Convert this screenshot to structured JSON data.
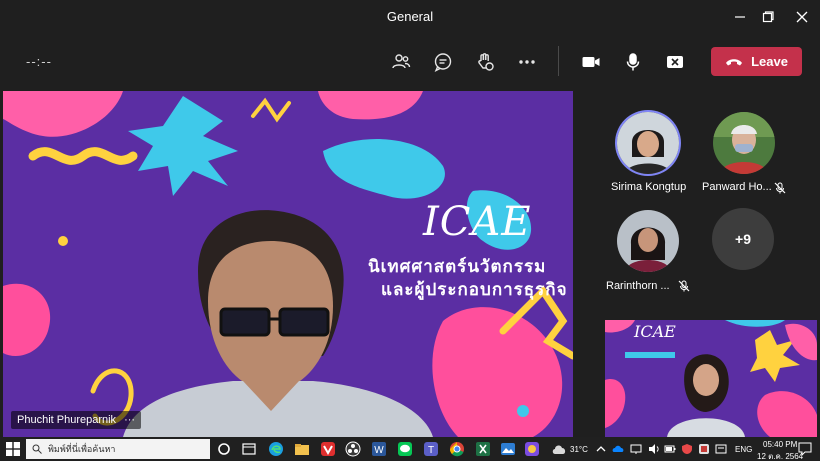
{
  "window": {
    "title": "General",
    "controls": [
      "minimize",
      "maximize",
      "close"
    ]
  },
  "toolbar": {
    "timer": "--:--",
    "icons": [
      "people-icon",
      "chat-icon",
      "reactions-icon",
      "more-icon",
      "camera-icon",
      "mic-icon",
      "share-icon"
    ],
    "leave_label": "Leave",
    "leave_color": "#c4314b"
  },
  "main_video": {
    "brand": "ICAE",
    "tagline_line1": "นิเทศศาสตร์นวัตกรรม",
    "tagline_line2": "และผู้ประกอบการธุรกิจ",
    "speaker_name": "Phuchit Phureparnik",
    "speaker_more": "···"
  },
  "participants": [
    {
      "name": "Sirima Kongtup",
      "muted": false,
      "active": true
    },
    {
      "name": "Panward Ho...",
      "muted": true,
      "active": false
    },
    {
      "name": "Rarinthorn ...",
      "muted": true,
      "active": false
    }
  ],
  "overflow": {
    "label": "+9"
  },
  "self_video": {
    "brand": "ICAE"
  },
  "taskbar": {
    "search_placeholder": "พิมพ์ที่นี่เพื่อค้นหา",
    "weather": "31°C",
    "lang": "ENG",
    "time": "05:40 PM",
    "date": "12 ต.ค. 2564"
  },
  "colors": {
    "accent": "#7f85f5",
    "background": "#1f1f1f",
    "video_purple": "#5a2d9e"
  }
}
